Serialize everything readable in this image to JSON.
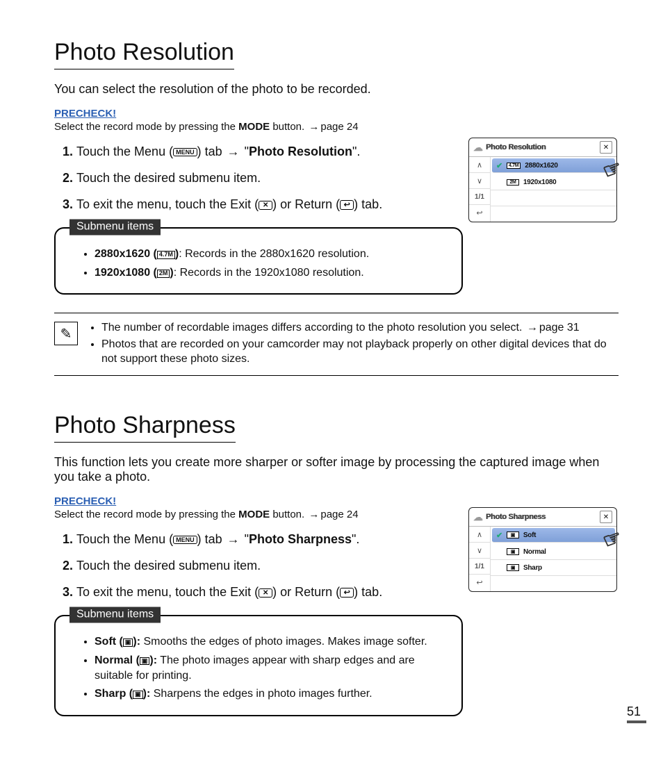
{
  "page_number": "51",
  "s1": {
    "title": "Photo Resolution",
    "intro": "You can select the resolution of the photo to be recorded.",
    "precheck_label": "PRECHECK!",
    "precheck_pre": "Select the record mode by pressing the ",
    "precheck_bold": "MODE",
    "precheck_post": " button. ",
    "precheck_ref": "page 24",
    "step1_a": "Touch the Menu (",
    "menu_chip": "MENU",
    "step1_b": ") tab ",
    "step1_c": " \"",
    "step1_bold": "Photo Resolution",
    "step1_d": "\".",
    "step2": "Touch the desired submenu item.",
    "step3_a": "To exit the menu, touch the Exit (",
    "step3_b": ") or Return (",
    "step3_c": ") tab.",
    "submenu_label": "Submenu items",
    "sub1_a": "2880x1620 (",
    "sub1_icon": "4.7M",
    "sub1_b": ")",
    "sub1_c": ": Records in the 2880x1620 resolution.",
    "sub2_a": "1920x1080 (",
    "sub2_icon": "2M",
    "sub2_b": ")",
    "sub2_c": ": Records in the 1920x1080 resolution.",
    "note1_a": "The number of recordable images differs according to the photo resolution you select. ",
    "note1_b": "page 31",
    "note2": "Photos that are recorded on your camcorder may not playback properly on other digital devices that do not support these photo sizes.",
    "ui": {
      "title": "Photo Resolution",
      "page": "1/1",
      "row1_icon": "4.7M",
      "row1": "2880x1620",
      "row2_icon": "2M",
      "row2": "1920x1080"
    }
  },
  "s2": {
    "title": "Photo Sharpness",
    "intro": "This function lets you create more sharper or softer image by processing the captured image when you take a photo.",
    "precheck_label": "PRECHECK!",
    "precheck_pre": "Select the record mode by pressing the ",
    "precheck_bold": "MODE",
    "precheck_post": " button. ",
    "precheck_ref": "page 24",
    "step1_a": "Touch the Menu (",
    "step1_b": ") tab ",
    "step1_c": " \"",
    "step1_bold": "Photo Sharpness",
    "step1_d": "\".",
    "step2": "Touch the desired submenu item.",
    "step3_a": "To exit the menu, touch the Exit (",
    "step3_b": ") or Return (",
    "step3_c": ") tab.",
    "submenu_label": "Submenu items",
    "sub1_a": "Soft (",
    "sub1_b": "):",
    "sub1_c": " Smooths the edges of photo images. Makes image softer.",
    "sub2_a": "Normal (",
    "sub2_b": "):",
    "sub2_c": " The photo images appear with sharp edges and are suitable for printing.",
    "sub3_a": "Sharp (",
    "sub3_b": "):",
    "sub3_c": " Sharpens the edges in photo images further.",
    "ui": {
      "title": "Photo Sharpness",
      "page": "1/1",
      "row1": "Soft",
      "row2": "Normal",
      "row3": "Sharp"
    }
  }
}
